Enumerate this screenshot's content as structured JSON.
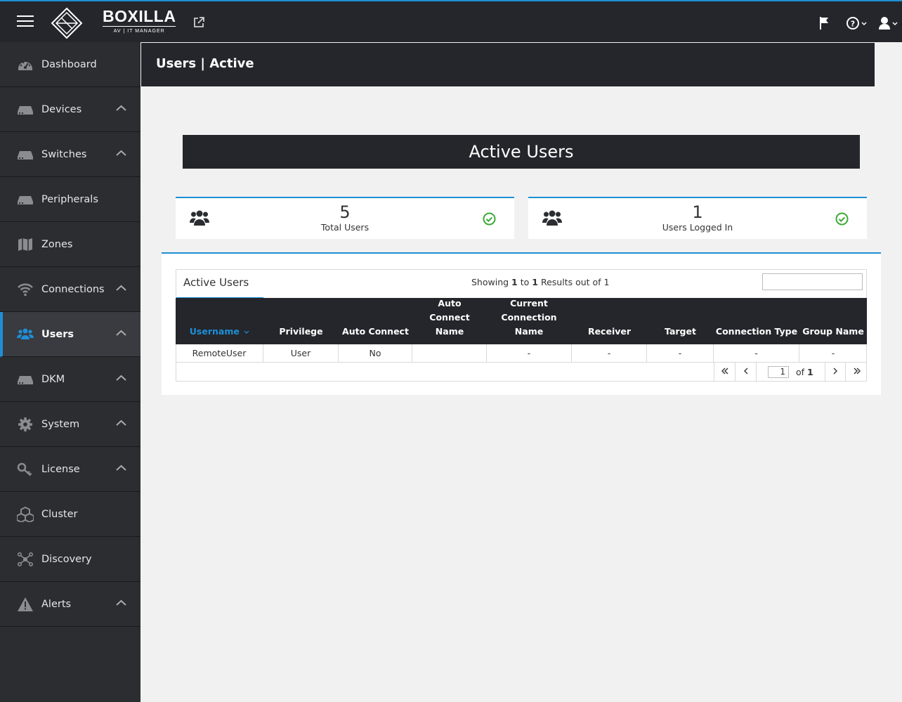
{
  "app": {
    "logo_main": "BOXILLA",
    "logo_sub": "AV | IT MANAGER"
  },
  "sidebar": {
    "items": [
      {
        "label": "Dashboard",
        "icon": "dashboard-icon",
        "expandable": false
      },
      {
        "label": "Devices",
        "icon": "device-icon",
        "expandable": true
      },
      {
        "label": "Switches",
        "icon": "switch-icon",
        "expandable": true
      },
      {
        "label": "Peripherals",
        "icon": "peripheral-icon",
        "expandable": false
      },
      {
        "label": "Zones",
        "icon": "map-icon",
        "expandable": false
      },
      {
        "label": "Connections",
        "icon": "wifi-icon",
        "expandable": true
      },
      {
        "label": "Users",
        "icon": "users-icon",
        "expandable": true,
        "active": true
      },
      {
        "label": "DKM",
        "icon": "device-icon",
        "expandable": true
      },
      {
        "label": "System",
        "icon": "gear-icon",
        "expandable": true
      },
      {
        "label": "License",
        "icon": "key-icon",
        "expandable": true
      },
      {
        "label": "Cluster",
        "icon": "cubes-icon",
        "expandable": false
      },
      {
        "label": "Discovery",
        "icon": "network-icon",
        "expandable": false
      },
      {
        "label": "Alerts",
        "icon": "warning-icon",
        "expandable": true
      }
    ]
  },
  "page": {
    "title": "Users | Active",
    "banner": "Active Users"
  },
  "cards": [
    {
      "value": "5",
      "label": "Total Users"
    },
    {
      "value": "1",
      "label": "Users Logged In"
    }
  ],
  "table": {
    "title": "Active Users",
    "showing_prefix": "Showing",
    "showing_from": "1",
    "showing_to_word": "to",
    "showing_to": "1",
    "showing_suffix": "Results out of 1",
    "search_value": "",
    "columns": [
      "Username",
      "Privilege",
      "Auto Connect",
      "Auto Connect Name",
      "Current Connection Name",
      "Receiver",
      "Target",
      "Connection Type",
      "Group Name"
    ],
    "rows": [
      [
        "RemoteUser",
        "User",
        "No",
        "",
        "-",
        "-",
        "-",
        "-",
        "-"
      ]
    ],
    "pager": {
      "current_page": "1",
      "of_word": "of",
      "total_pages": "1"
    }
  },
  "colors": {
    "accent": "#1e8fd6",
    "dark": "#24262b",
    "sidebar": "#2b2d31",
    "success": "#3aa935"
  }
}
